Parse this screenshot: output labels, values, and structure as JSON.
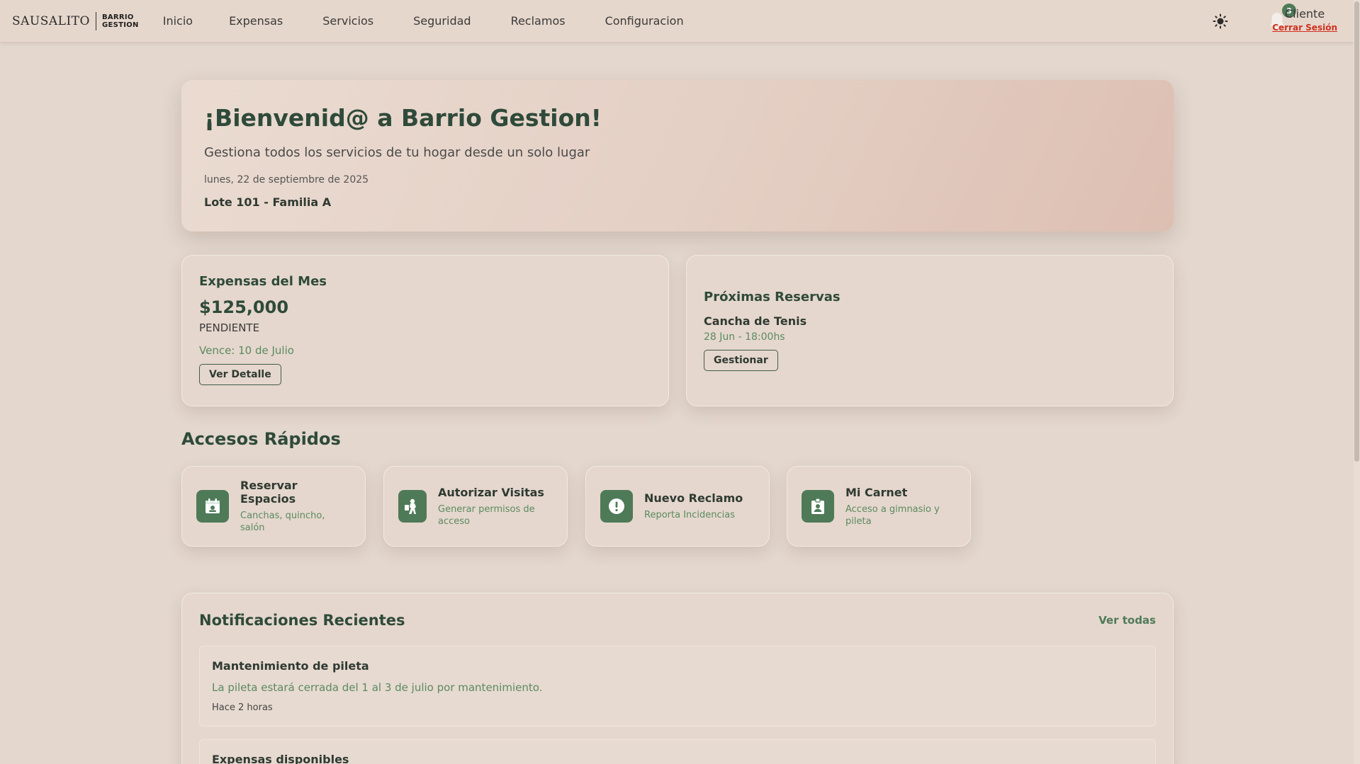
{
  "header": {
    "logo_left": "SAUSALITO",
    "logo_right_line1": "BARRIO",
    "logo_right_line2": "GESTION",
    "nav": [
      "Inicio",
      "Expensas",
      "Servicios",
      "Seguridad",
      "Reclamos",
      "Configuracion"
    ],
    "notification_count": "3",
    "user": "Cliente",
    "logout": "Cerrar Sesión"
  },
  "welcome": {
    "title": "¡Bienvenid@ a Barrio Gestion!",
    "subtitle": "Gestiona todos los servicios de tu hogar desde un solo lugar",
    "date": "lunes, 22 de septiembre de 2025",
    "lot": "Lote 101 - Familia A"
  },
  "expenses_card": {
    "title": "Expensas del Mes",
    "amount": "$125,000",
    "status": "PENDIENTE",
    "due": "Vence: 10 de Julio",
    "button": "Ver Detalle"
  },
  "reservations_card": {
    "title": "Próximas Reservas",
    "item": "Cancha de Tenis",
    "time": "28 Jun - 18:00hs",
    "button": "Gestionar"
  },
  "quick_access": {
    "title": "Accesos Rápidos",
    "items": [
      {
        "title": "Reservar Espacios",
        "desc": "Canchas, quincho, salón",
        "icon": "calendar-icon"
      },
      {
        "title": "Autorizar Visitas",
        "desc": "Generar permisos de acceso",
        "icon": "visitor-icon"
      },
      {
        "title": "Nuevo Reclamo",
        "desc": "Reporta Incidencias",
        "icon": "alert-icon"
      },
      {
        "title": "Mi Carnet",
        "desc": "Acceso a gimnasio y pileta",
        "icon": "id-badge-icon"
      }
    ]
  },
  "notifications": {
    "title": "Notificaciones Recientes",
    "see_all": "Ver todas",
    "items": [
      {
        "title": "Mantenimiento de pileta",
        "body": "La pileta estará cerrada del 1 al 3 de julio por mantenimiento.",
        "time": "Hace 2 horas"
      },
      {
        "title": "Expensas disponibles",
        "body": "",
        "time": ""
      }
    ]
  },
  "colors": {
    "accent": "#4f7a58",
    "heading": "#2f4a3a",
    "background": "#e3d7ce",
    "logout": "#d0301f"
  }
}
